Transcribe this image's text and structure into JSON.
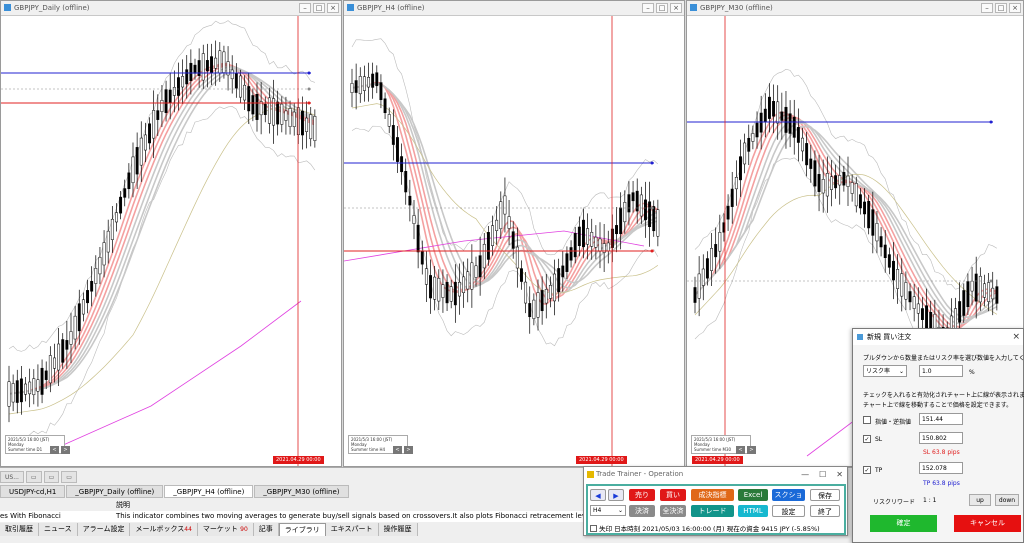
{
  "charts": {
    "daily": {
      "title": "GBPJPY_Daily (offline)",
      "info": [
        "2021/5/3 16:00 (JST)",
        "Monday",
        "Summer time  D1"
      ],
      "date": "2021.04.29 00:00"
    },
    "h4": {
      "title": "GBPJPY_H4 (offline)",
      "info": [
        "2021/5/3 16:00 (JST)",
        "Monday",
        "Summer time  H4"
      ],
      "date": "2021.04.29 00:00"
    },
    "m30": {
      "title": "GBPJPY_M30 (offline)",
      "info": [
        "2021/5/3 16:00 (JST)",
        "Monday",
        "Summer time  M30"
      ],
      "date": "2021.04.29 00:00"
    }
  },
  "minitabs": [
    "US...",
    "",
    "",
    ""
  ],
  "window_tabs": [
    "USDJPY-cd,H1",
    "_GBPJPY_Daily (offline)",
    "_GBPJPY_H4 (offline)",
    "_GBPJPY_M30 (offline)"
  ],
  "panel": {
    "col_header": "説明",
    "name": "es With Fibonacci",
    "description": "This indicator combines two moving averages to generate buy/sell signals based on crossovers.It also plots Fibonacci retracement levels using recent"
  },
  "bottom_tabs": [
    {
      "label": "取引履歴",
      "count": ""
    },
    {
      "label": "ニュース",
      "count": ""
    },
    {
      "label": "アラーム設定",
      "count": ""
    },
    {
      "label": "メールボックス",
      "count": "44"
    },
    {
      "label": "マーケット",
      "count": "90"
    },
    {
      "label": "記事",
      "count": ""
    },
    {
      "label": "ライブラリ",
      "count": ""
    },
    {
      "label": "エキスパート",
      "count": ""
    },
    {
      "label": "操作履歴",
      "count": ""
    }
  ],
  "trade_trainer": {
    "title": "Trade Trainer - Operation",
    "controls": [
      "—",
      "☐",
      "✕"
    ],
    "timeframe": "H4",
    "buttons": {
      "sell": "売り",
      "buy": "買い",
      "limit": "成決指標",
      "excel": "Excel",
      "screenshot": "スクショ",
      "save": "保存",
      "settle": "決済",
      "settle_all": "全決済",
      "trade": "トレード",
      "html": "HTML",
      "settings": "設定",
      "exit": "終了"
    },
    "status": {
      "mode": "失印",
      "time_label": "日本時刻",
      "time": "2021/05/03 16:00:00 (月)",
      "funds_label": "現在の資金",
      "funds": "9415 JPY (-5.85%)"
    }
  },
  "order_dialog": {
    "title": "新規 買い注文",
    "instruction": "プルダウンから数量またはリスク率を選び数値を入力してください。",
    "mode": "リスク率",
    "risk_value": "1.0",
    "risk_unit": "%",
    "note1": "チェックを入れると有効化されチャート上に線が表示されます。",
    "note2": "チャート上で線を移動することで価格を設定できます。",
    "limit_label": "指値・逆指値",
    "limit_value": "151.44",
    "sl_label": "SL",
    "sl_value": "150.802",
    "sl_pips": "SL 63.8 pips",
    "tp_label": "TP",
    "tp_value": "152.078",
    "tp_pips": "TP 63.8 pips",
    "rr_label": "リスクリワード",
    "rr_value": "1 : 1",
    "up": "up",
    "down": "down",
    "confirm": "確定",
    "cancel": "キャンセル"
  },
  "colors": {
    "sell": "#e01818",
    "buy": "#1c9a1c",
    "limit": "#e06818",
    "excel": "#2a7a3a",
    "screenshot": "#1a6ad8",
    "teal": "#12948a",
    "cyan": "#16b8cf",
    "gray": "#8a8a8a",
    "blue_line": "#2020d0",
    "red_line": "#e02020"
  }
}
